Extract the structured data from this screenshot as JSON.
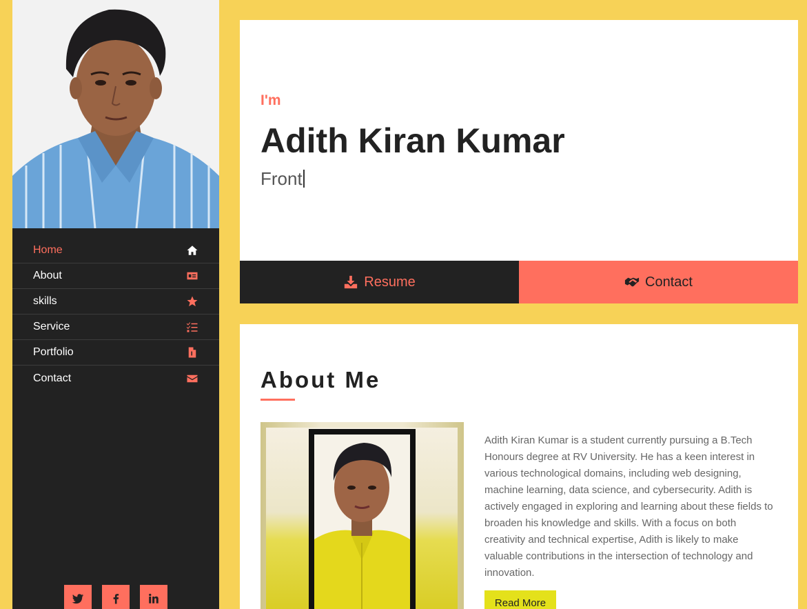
{
  "sidebar": {
    "nav": [
      {
        "label": "Home",
        "icon": "home-icon"
      },
      {
        "label": "About",
        "icon": "id-card-icon"
      },
      {
        "label": "skills",
        "icon": "star-icon"
      },
      {
        "label": "Service",
        "icon": "tasks-icon"
      },
      {
        "label": "Portfolio",
        "icon": "file-icon"
      },
      {
        "label": "Contact",
        "icon": "envelope-icon"
      }
    ],
    "active_index": 0,
    "social": [
      "twitter-icon",
      "facebook-icon",
      "linkedin-icon"
    ]
  },
  "hero": {
    "intro": "I'm",
    "name": "Adith Kiran Kumar",
    "role_typed": "Front",
    "resume_label": "Resume",
    "contact_label": "Contact"
  },
  "about": {
    "title": "About Me",
    "text": "Adith Kiran Kumar is a student currently pursuing a B.Tech Honours degree at RV University. He has a keen interest in various technological domains, including web designing, machine learning, data science, and cybersecurity. Adith is actively engaged in exploring and learning about these fields to broaden his knowledge and skills. With a focus on both creativity and technical expertise, Adith is likely to make valuable contributions in the intersection of technology and innovation.",
    "read_more": "Read More"
  },
  "colors": {
    "accent": "#ff6f5e",
    "background": "#f7d257",
    "dark": "#222222",
    "button_yellow": "#e4e11b"
  }
}
